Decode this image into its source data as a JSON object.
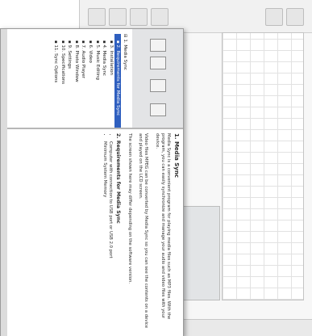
{
  "help": {
    "tree": {
      "items": [
        {
          "label": "1. Media Sync"
        },
        {
          "label": "2. Requirements for Media Sync"
        },
        {
          "label": "3. Installation"
        },
        {
          "label": "4. Media Sync"
        },
        {
          "label": "5. Music Editing"
        },
        {
          "label": "6. Video"
        },
        {
          "label": "7. Audio Player"
        },
        {
          "label": "8. Photo Window"
        },
        {
          "label": "9. Settings"
        },
        {
          "label": "10. Specifications"
        },
        {
          "label": "11. Sync Options"
        }
      ]
    },
    "content": {
      "section1_title": "1. Media Sync",
      "para1": "Media Sync is a convenient program for playing media files such as MP3 files. With the program, you can easily synchronize and manage your audio and video files with your device.",
      "para2": "Video files MPEG can be converted by Media Sync so you can see the contents on a device and played on the LCD screen.",
      "para3": "The screen shown here may differ depending on the software version.",
      "section2_title": "2. Requirements for Media Sync",
      "bullet1": "Computer with connection to USB port or USB 2.0 port",
      "bullet2": "Minimum System Memory"
    }
  }
}
